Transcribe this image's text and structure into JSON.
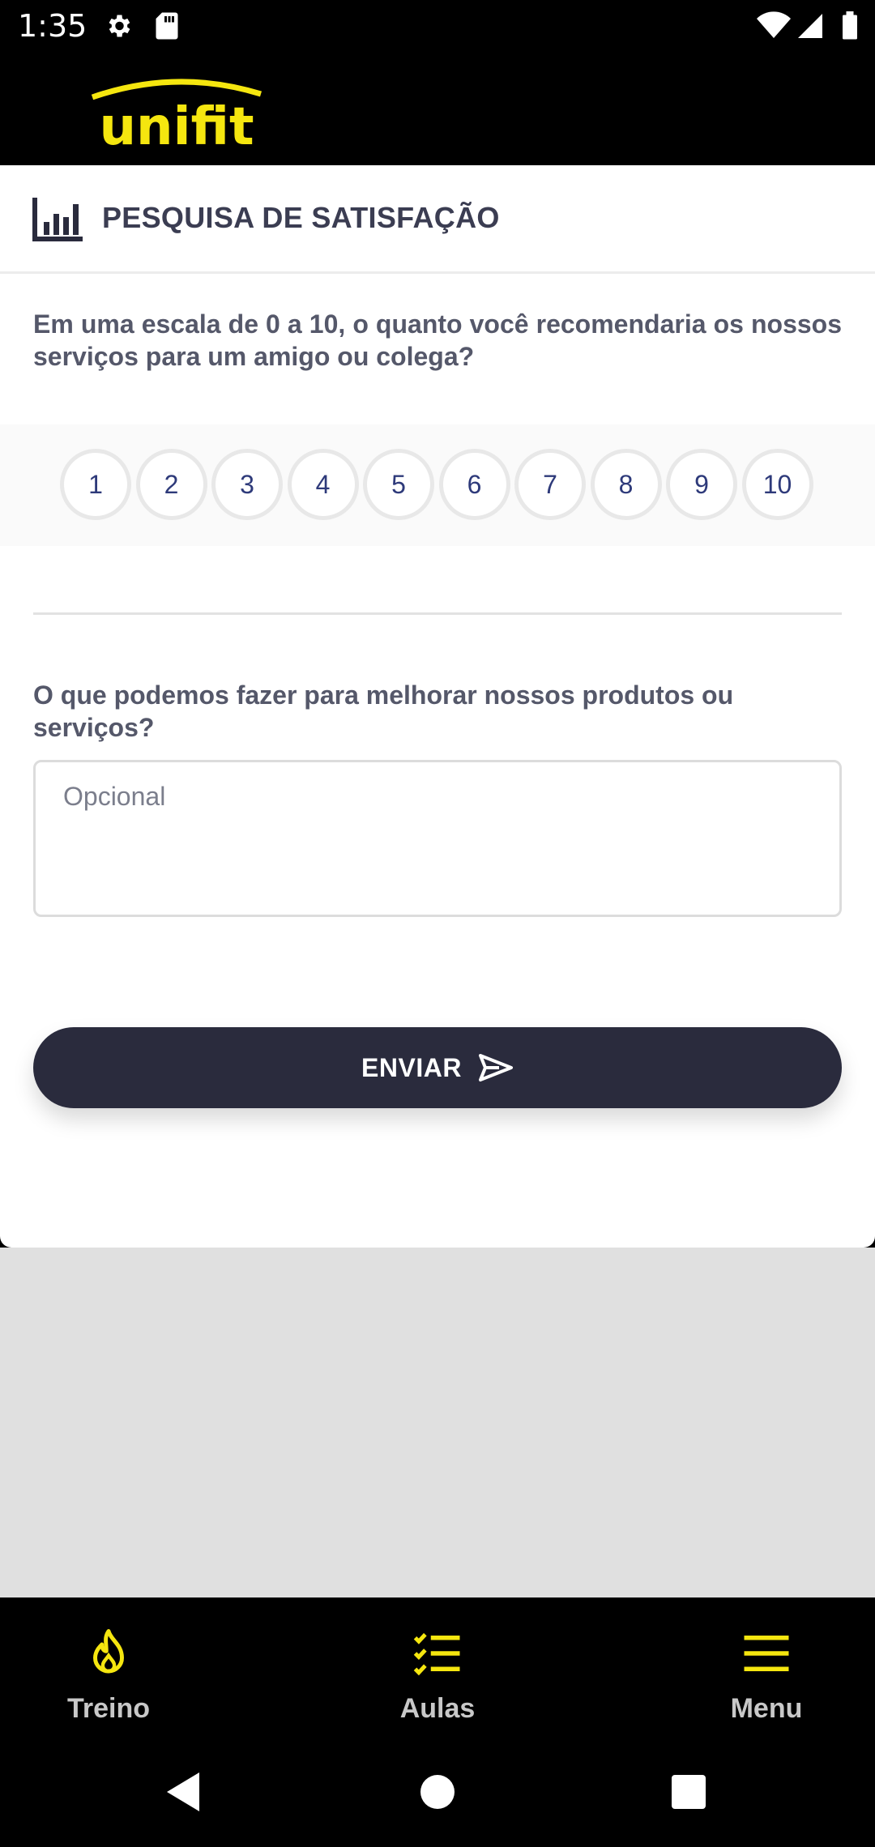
{
  "status_bar": {
    "time": "1:35"
  },
  "header": {
    "logo_text": "unifit"
  },
  "survey": {
    "title": "PESQUISA DE SATISFAÇÃO",
    "question1": "Em uma escala de 0 a 10, o quanto você recomendaria os nossos serviços para um amigo ou colega?",
    "ratings": [
      "1",
      "2",
      "3",
      "4",
      "5",
      "6",
      "7",
      "8",
      "9",
      "10"
    ],
    "question2": "O que podemos fazer para melhorar nossos produtos ou serviços?",
    "feedback_value": "",
    "feedback_placeholder": "Opcional",
    "submit_label": "ENVIAR"
  },
  "bottom_nav": {
    "items": [
      {
        "label": "Treino",
        "icon": "flame-icon"
      },
      {
        "label": "Aulas",
        "icon": "checklist-icon"
      },
      {
        "label": "Menu",
        "icon": "hamburger-icon"
      }
    ]
  },
  "colors": {
    "accent": "#f5e60f",
    "button_dark": "#2a2b3d",
    "title_text": "#3b3d52",
    "rating_number": "#2e3a7a",
    "background_gray": "#e0e0e0"
  }
}
